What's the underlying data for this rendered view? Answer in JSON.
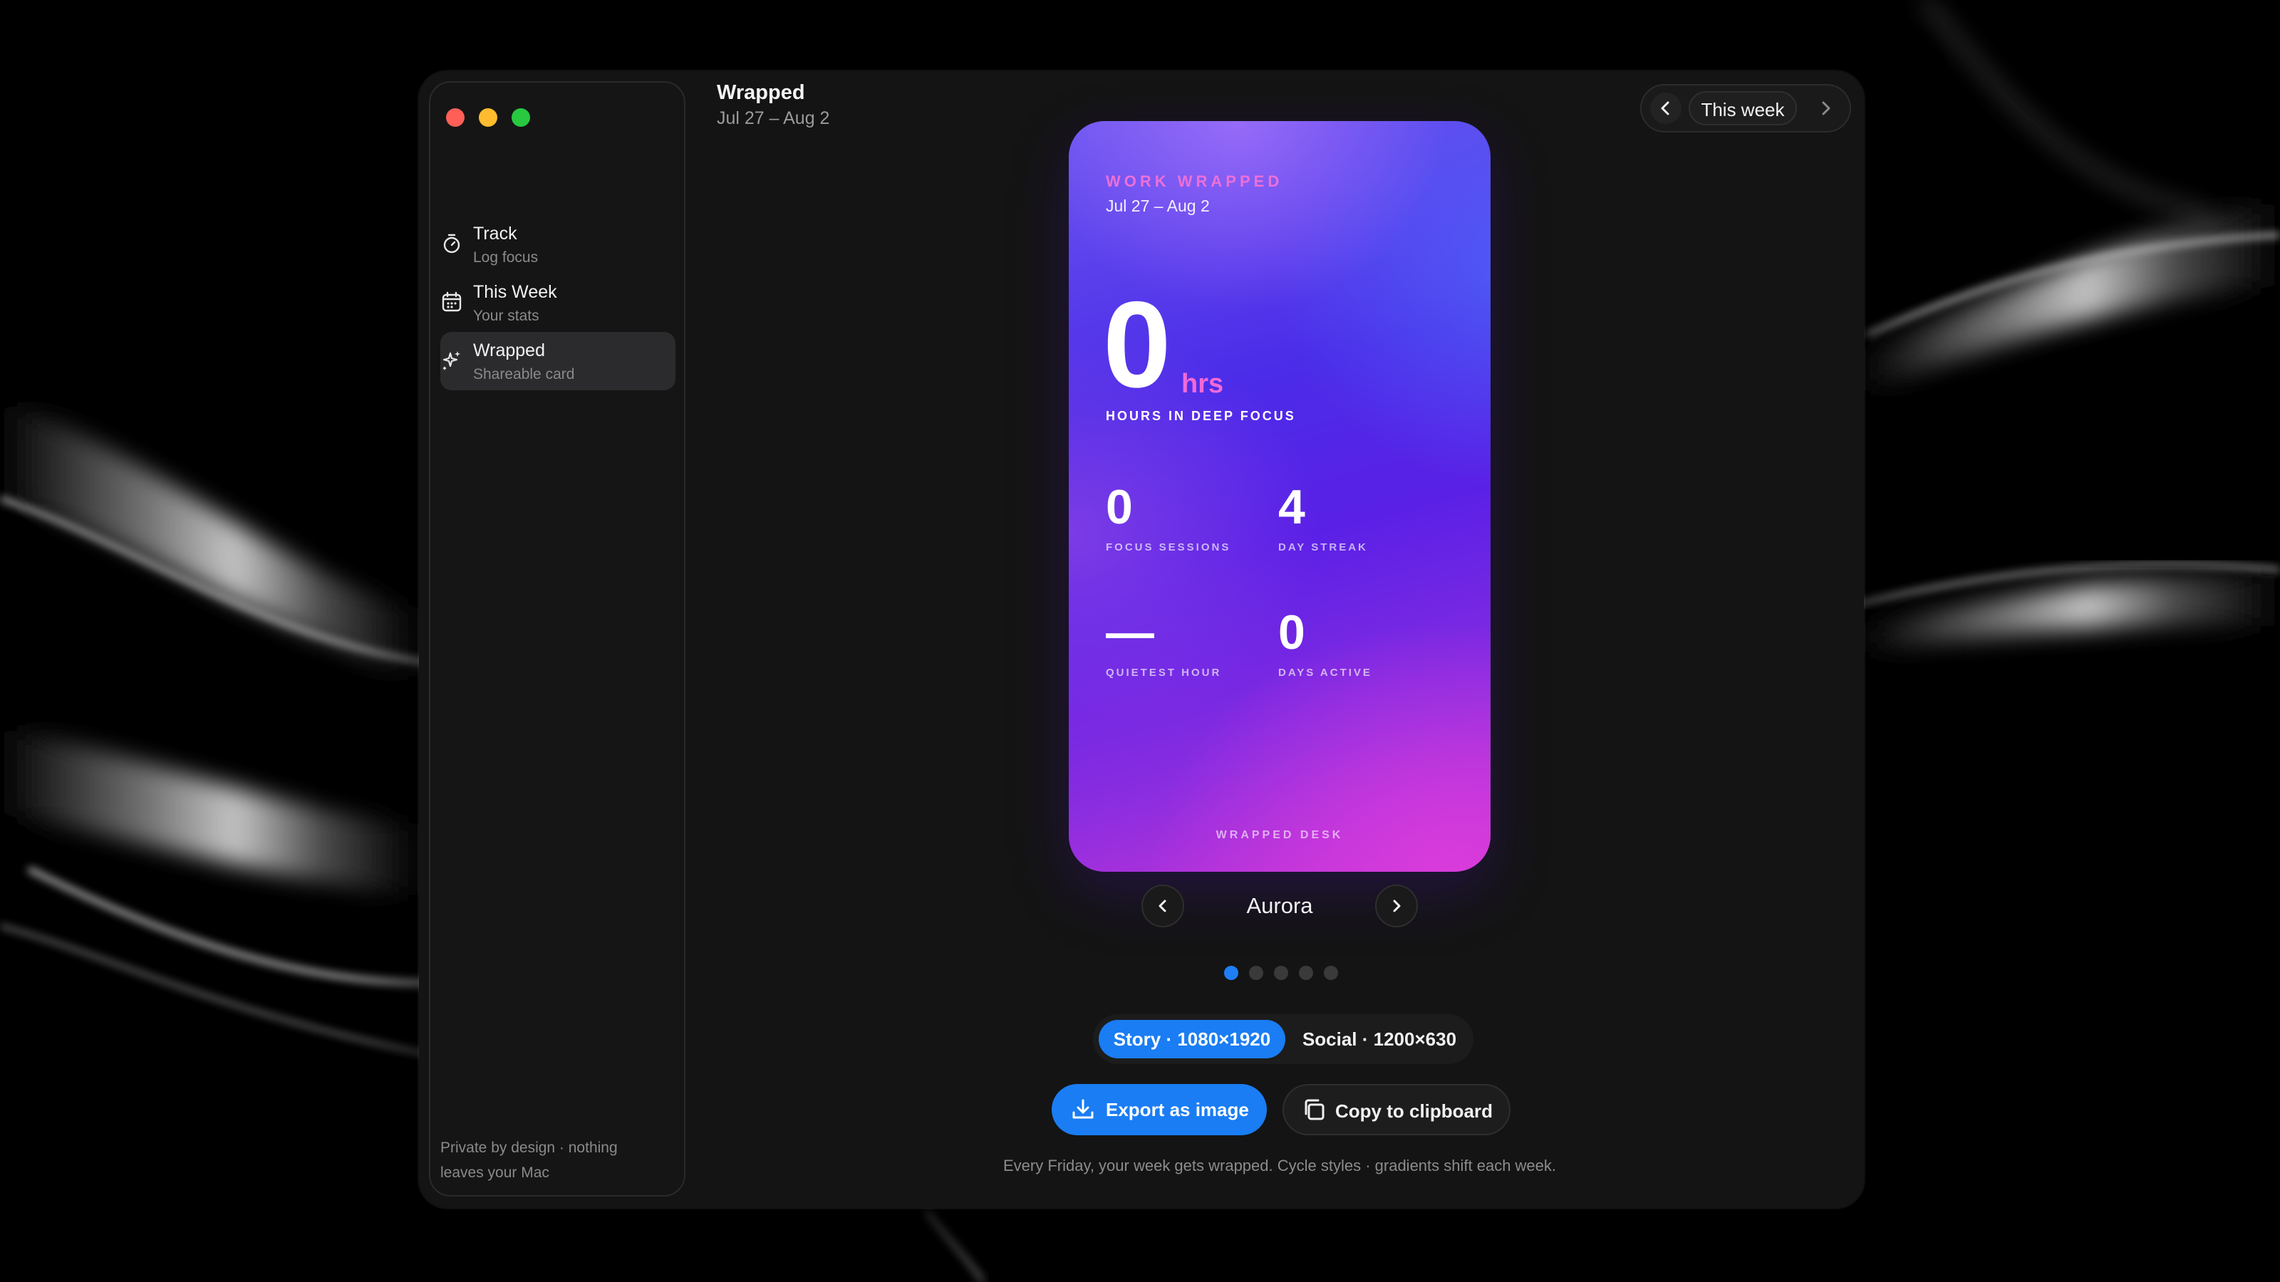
{
  "sidebar": {
    "items": [
      {
        "title": "Track",
        "subtitle": "Log focus",
        "icon": "stopwatch-icon"
      },
      {
        "title": "This Week",
        "subtitle": "Your stats",
        "icon": "calendar-icon"
      },
      {
        "title": "Wrapped",
        "subtitle": "Shareable card",
        "icon": "sparkles-icon"
      }
    ],
    "active_index": 2,
    "footer_line1": "Private by design · nothing",
    "footer_line2": "leaves your Mac"
  },
  "header": {
    "title": "Wrapped",
    "date_range": "Jul 27 – Aug 2"
  },
  "week_nav": {
    "label": "This week"
  },
  "card": {
    "eyebrow": "WORK WRAPPED",
    "date_range": "Jul 27 – Aug 2",
    "hours_value": "0",
    "hours_unit": "hrs",
    "hours_label": "HOURS IN DEEP FOCUS",
    "stats": [
      {
        "value": "0",
        "label": "FOCUS SESSIONS"
      },
      {
        "value": "4",
        "label": "DAY STREAK"
      },
      {
        "value": "—",
        "label": "QUIETEST HOUR"
      },
      {
        "value": "0",
        "label": "DAYS ACTIVE"
      }
    ],
    "footer": "WRAPPED DESK"
  },
  "style_picker": {
    "name": "Aurora",
    "total_styles": 5,
    "active_index": 0
  },
  "formats": [
    {
      "label": "Story · 1080×1920",
      "active": true
    },
    {
      "label": "Social · 1200×630",
      "active": false
    }
  ],
  "actions": {
    "export_label": "Export as image",
    "copy_label": "Copy to clipboard"
  },
  "tagline": "Every Friday, your week gets wrapped. Cycle styles · gradients shift each week.",
  "colors": {
    "accent": "#1a7df3",
    "card_pink": "#ec70d8",
    "card_purple": "#5a20e6"
  }
}
